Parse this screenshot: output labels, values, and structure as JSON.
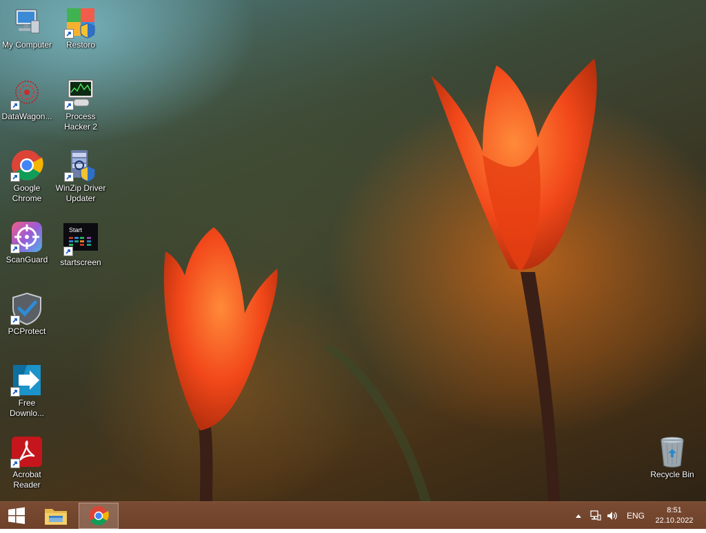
{
  "desktop": {
    "icons": [
      {
        "label": "My Computer"
      },
      {
        "label": "Restoro"
      },
      {
        "label": "DataWagon..."
      },
      {
        "label": "Process\nHacker 2"
      },
      {
        "label": "Google\nChrome"
      },
      {
        "label": "WinZip Driver\nUpdater"
      },
      {
        "label": "ScanGuard"
      },
      {
        "label": "startscreen",
        "thumb_text": "Start"
      },
      {
        "label": "PCProtect"
      },
      {
        "label": "Free\nDownlo..."
      },
      {
        "label": "Acrobat\nReader"
      },
      {
        "label": "Recycle Bin"
      }
    ]
  },
  "taskbar": {
    "language": "ENG",
    "time": "8:51",
    "date": "22.10.2022"
  },
  "colors": {
    "taskbar": "#6e4129",
    "label_text": "#ffffff"
  }
}
